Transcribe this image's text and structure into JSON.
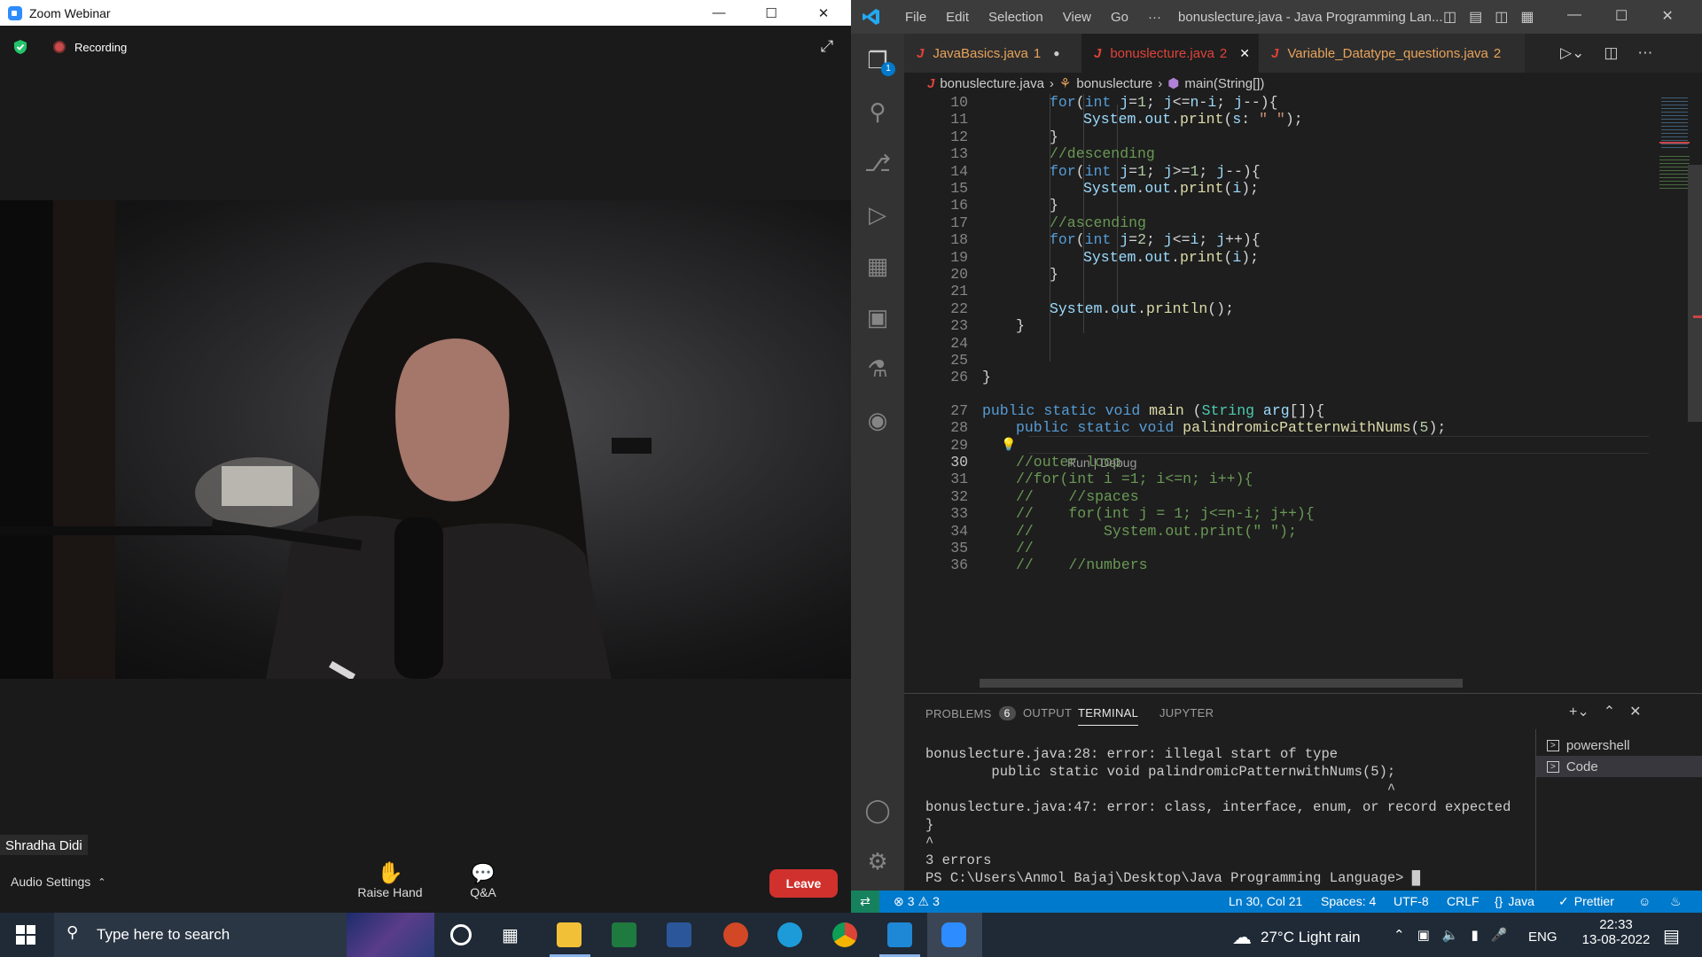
{
  "zoom": {
    "window_title": "Zoom Webinar",
    "recording_label": "Recording",
    "participant_name": "Shradha Didi",
    "audio_settings_label": "Audio Settings",
    "raise_hand_label": "Raise Hand",
    "qa_label": "Q&A",
    "leave_label": "Leave"
  },
  "vscode": {
    "window_title": "bonuslecture.java - Java Programming Lan...",
    "menu": [
      "File",
      "Edit",
      "Selection",
      "View",
      "Go",
      "···"
    ],
    "tabs": [
      {
        "label": "JavaBasics.java",
        "badge": "1"
      },
      {
        "label": "bonuslecture.java",
        "badge": "2"
      },
      {
        "label": "Variable_Datatype_questions.java",
        "badge": "2"
      }
    ],
    "breadcrumb": [
      "bonuslecture.java",
      "bonuslecture",
      "main(String[])"
    ],
    "explorer_badge": "1",
    "codelens": "Run | Debug",
    "line_numbers": [
      "10",
      "11",
      "12",
      "13",
      "14",
      "15",
      "16",
      "17",
      "18",
      "19",
      "20",
      "21",
      "22",
      "23",
      "24",
      "25",
      "26",
      "27",
      "28",
      "29",
      "30",
      "31",
      "32",
      "33",
      "34",
      "35",
      "36"
    ],
    "code_lines": [
      "for(int j=1; j<=n-i; j--){",
      "System.out.print(s: \" \");",
      "}",
      "//descending",
      "for(int j=1; j>=1; j--){",
      "System.out.print(i);",
      "}",
      "//ascending",
      "for(int j=2; j<=i; j++){",
      "System.out.print(i);",
      "}",
      "",
      "System.out.println();",
      "}",
      "",
      "",
      "}",
      "public static void main (String arg[]){",
      "public static void palindromicPatternwithNums(5);",
      "",
      "//outer loop",
      "//for(int i =1; i<=n; i++){",
      "//    //spaces",
      "//    for(int j = 1; j<=n-i; j++){",
      "//        System.out.print(\" \");",
      "//",
      "//    //numbers"
    ],
    "panel_tabs": {
      "problems": "PROBLEMS",
      "problems_count": "6",
      "output": "OUTPUT",
      "terminal": "TERMINAL",
      "jupyter": "JUPYTER"
    },
    "terminal_lines": [
      "bonuslecture.java:28: error: illegal start of type",
      "        public static void palindromicPatternwithNums(5);",
      "                                                        ^",
      "bonuslecture.java:47: error: class, interface, enum, or record expected",
      "}",
      "^",
      "3 errors",
      "PS C:\\Users\\Anmol Bajaj\\Desktop\\Java Programming Language> "
    ],
    "terminal_list": [
      "powershell",
      "Code"
    ],
    "status": {
      "errors": "3",
      "warnings": "3",
      "position": "Ln 30, Col 21",
      "spaces": "Spaces: 4",
      "encoding": "UTF-8",
      "eol": "CRLF",
      "language": "Java",
      "formatter": "Prettier"
    }
  },
  "taskbar": {
    "search_placeholder": "Type here to search",
    "weather": "27°C  Light rain",
    "lang": "ENG",
    "time": "22:33",
    "date": "13-08-2022"
  }
}
